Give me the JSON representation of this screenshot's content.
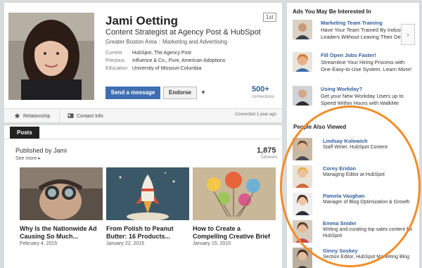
{
  "profile": {
    "name": "Jami Oetting",
    "degree": "1st",
    "headline": "Content Strategist at Agency Post & HubSpot",
    "location": "Greater Boston Area",
    "industry": "Marketing and Advertising",
    "facts": [
      {
        "label": "Current",
        "value": "HubSpot, The Agency Post"
      },
      {
        "label": "Previous",
        "value": "Influence & Co., Pure, American Adoptions"
      },
      {
        "label": "Education",
        "value": "University of Missouri-Columbia"
      }
    ],
    "send_message_label": "Send a message",
    "endorse_label": "Endorse",
    "connections_count": "500+",
    "connections_label": "connections",
    "tabs": {
      "relationship": "Relationship",
      "contact": "Contact Info"
    },
    "connected": "Connected 1 year ago"
  },
  "posts": {
    "tab_label": "Posts",
    "published_by": "Published by Jami",
    "see_more": "See more ▸",
    "followers_count": "1,875",
    "followers_label": "followers",
    "items": [
      {
        "title": "Why Is the Nationwide Ad Causing So Much...",
        "date": "February 4, 2015"
      },
      {
        "title": "From Polish to Peanut Butter: 16 Products...",
        "date": "January 22, 2015"
      },
      {
        "title": "How to Create a Compelling Creative Brief",
        "date": "January 15, 2015"
      }
    ]
  },
  "ads": {
    "title": "Ads You May Be Interested In",
    "next_label": "›",
    "items": [
      {
        "title": "Marketing Team Training",
        "body": "Have Your Team Trained By Industry Leaders Without Leaving Their Desks."
      },
      {
        "title": "Fill Open Jobs Faster!",
        "body": "Streamline Your Hiring Process with One Easy-to-Use System. Learn More!"
      },
      {
        "title": "Using Workday?",
        "body": "Get your New Workday Users up to Speed Within Hours with WalkMe"
      }
    ]
  },
  "people_also_viewed": {
    "title": "People Also Viewed",
    "items": [
      {
        "name": "Lindsay Kolowich",
        "title": "Staff Writer, HubSpot Content"
      },
      {
        "name": "Corey Eridon",
        "title": "Managing Editor at HubSpot"
      },
      {
        "name": "Pamela Vaughan",
        "title": "Manager of Blog Optimization & Growth"
      },
      {
        "name": "Emma Snider",
        "title": "Writing and curating top sales content for HubSpot"
      },
      {
        "name": "Ginny Soskey",
        "title": "Section Editor, HubSpot Marketing Blog"
      }
    ]
  },
  "colors": {
    "link": "#2f5e9c",
    "primary_button": "#3f6fb2",
    "highlight": "#f28c28"
  }
}
